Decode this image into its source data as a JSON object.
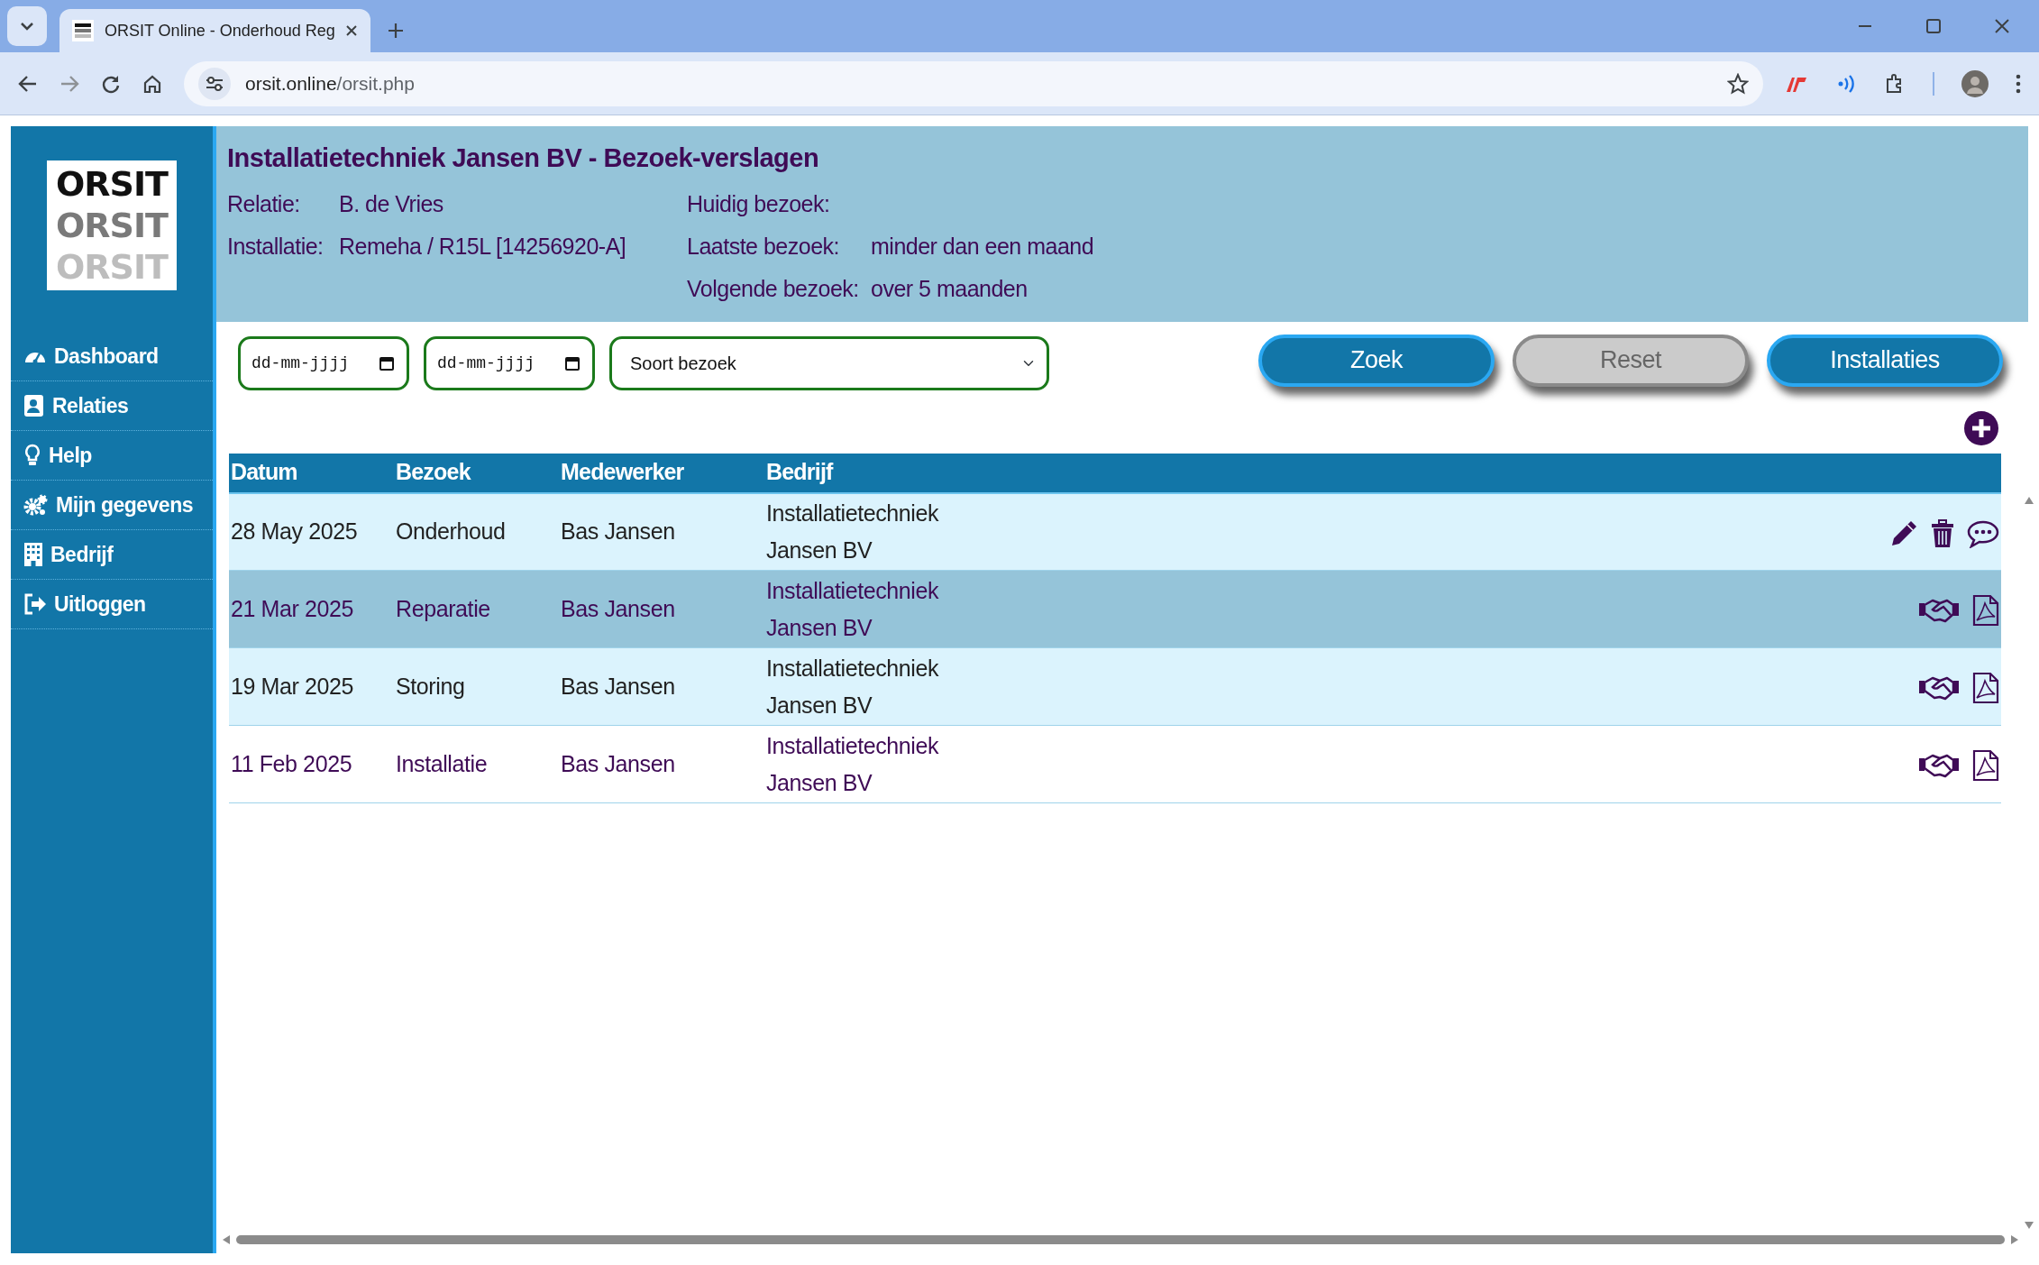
{
  "browser": {
    "tab_title": "ORSIT Online - Onderhoud Reg",
    "url_host": "orsit.online",
    "url_path": "/orsit.php"
  },
  "logo": {
    "lines": [
      "ORSIT",
      "ORSIT",
      "ORSIT"
    ]
  },
  "sidebar": {
    "items": [
      {
        "label": "Dashboard"
      },
      {
        "label": "Relaties"
      },
      {
        "label": "Help"
      },
      {
        "label": "Mijn gegevens"
      },
      {
        "label": "Bedrijf"
      },
      {
        "label": "Uitloggen"
      }
    ]
  },
  "header": {
    "title": "Installatietechniek Jansen BV - Bezoek-verslagen",
    "left_fields": [
      {
        "label": "Relatie:",
        "value": "B. de Vries"
      },
      {
        "label": "Installatie:",
        "value": "Remeha / R15L [14256920-A]"
      }
    ],
    "right_fields": [
      {
        "label": "Huidig bezoek:"
      },
      {
        "label": "Laatste bezoek:",
        "value": "minder dan een maand"
      },
      {
        "label": "Volgende bezoek:",
        "value": "over 5 maanden"
      }
    ]
  },
  "filters": {
    "date_from": {
      "placeholder": "dd-mm-jjjj"
    },
    "date_to": {
      "placeholder": "dd-mm-jjjj"
    },
    "visit_type": {
      "value": "Soort bezoek"
    }
  },
  "buttons": [
    {
      "label": "Zoek",
      "disabled": false
    },
    {
      "label": "Reset",
      "disabled": true
    },
    {
      "label": "Installaties",
      "disabled": false
    }
  ],
  "table": {
    "columns": [
      "Datum",
      "Bezoek",
      "Medewerker",
      "Bedrijf"
    ],
    "rows": [
      {
        "datum": "28 May 2025",
        "bezoek": "Onderhoud",
        "medewerker": "Bas Jansen",
        "bedrijf": "Installatietechniek Jansen BV",
        "kind": "open",
        "selected": false
      },
      {
        "datum": "21 Mar 2025",
        "bezoek": "Reparatie",
        "medewerker": "Bas Jansen",
        "bedrijf": "Installatietechniek Jansen BV",
        "kind": "closed",
        "selected": true
      },
      {
        "datum": "19 Mar 2025",
        "bezoek": "Storing",
        "medewerker": "Bas Jansen",
        "bedrijf": "Installatietechniek Jansen BV",
        "kind": "closed",
        "selected": false
      },
      {
        "datum": "11 Feb 2025",
        "bezoek": "Installatie",
        "medewerker": "Bas Jansen",
        "bedrijf": "Installatietechniek Jansen BV",
        "kind": "closed",
        "selected": false
      }
    ]
  }
}
